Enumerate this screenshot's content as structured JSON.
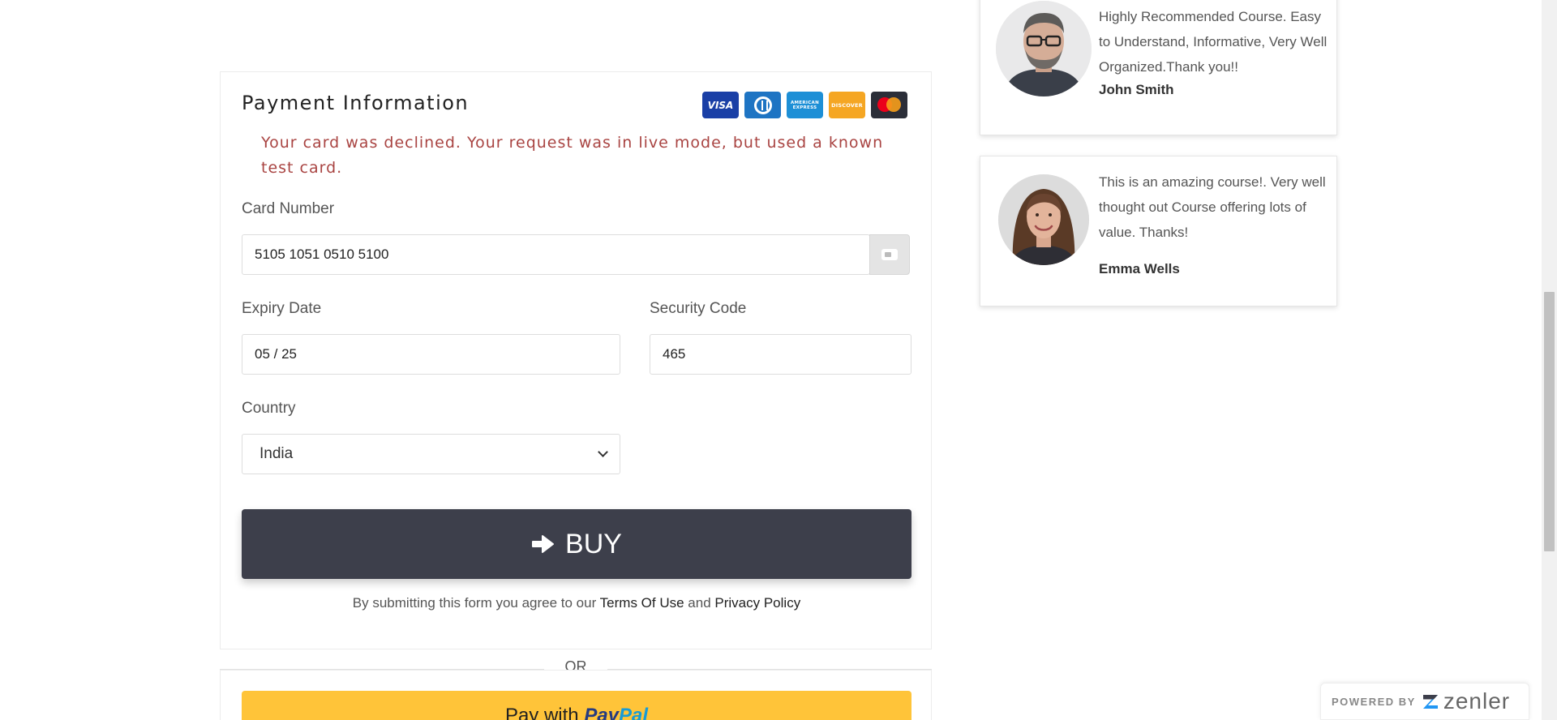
{
  "payment": {
    "title": "Payment Information",
    "error": "Your card was declined. Your request was in live mode, but used a known test card.",
    "card_logos": {
      "visa": "VISA",
      "amex": "AMERICAN EXPRESS",
      "discover": "DISCOVER"
    },
    "card_number": {
      "label": "Card Number",
      "value": "5105 1051 0510 5100"
    },
    "expiry": {
      "label": "Expiry Date",
      "value": "05 / 25"
    },
    "security": {
      "label": "Security Code",
      "value": "465"
    },
    "country": {
      "label": "Country",
      "selected": "India"
    },
    "buy_label": "BUY",
    "terms": {
      "prefix": "By submitting this form you agree to our ",
      "terms_link": "Terms Of Use",
      "and": " and ",
      "privacy_link": "Privacy Policy"
    },
    "or_label": "OR",
    "paypal": {
      "pay_with": "Pay with ",
      "brand_1": "Pay",
      "brand_2": "Pal"
    }
  },
  "testimonials": [
    {
      "quote": "Highly Recommended Course. Easy to Understand, Informative, Very Well Organized.Thank you!!",
      "author": "John Smith"
    },
    {
      "quote": "This is an amazing course!. Very well thought out Course offering lots of value. Thanks!",
      "author": "Emma Wells"
    }
  ],
  "footer": {
    "powered_by": "POWERED BY",
    "brand": "zenler"
  },
  "icons": {
    "buy": "arrow-right-circle-icon",
    "card": "credit-card-icon",
    "select": "chevron-down-icon"
  },
  "colors": {
    "error": "#a94442",
    "buy_button": "#3d3f4b",
    "paypal": "#ffc439",
    "zenler_accent": "#2196f3"
  }
}
